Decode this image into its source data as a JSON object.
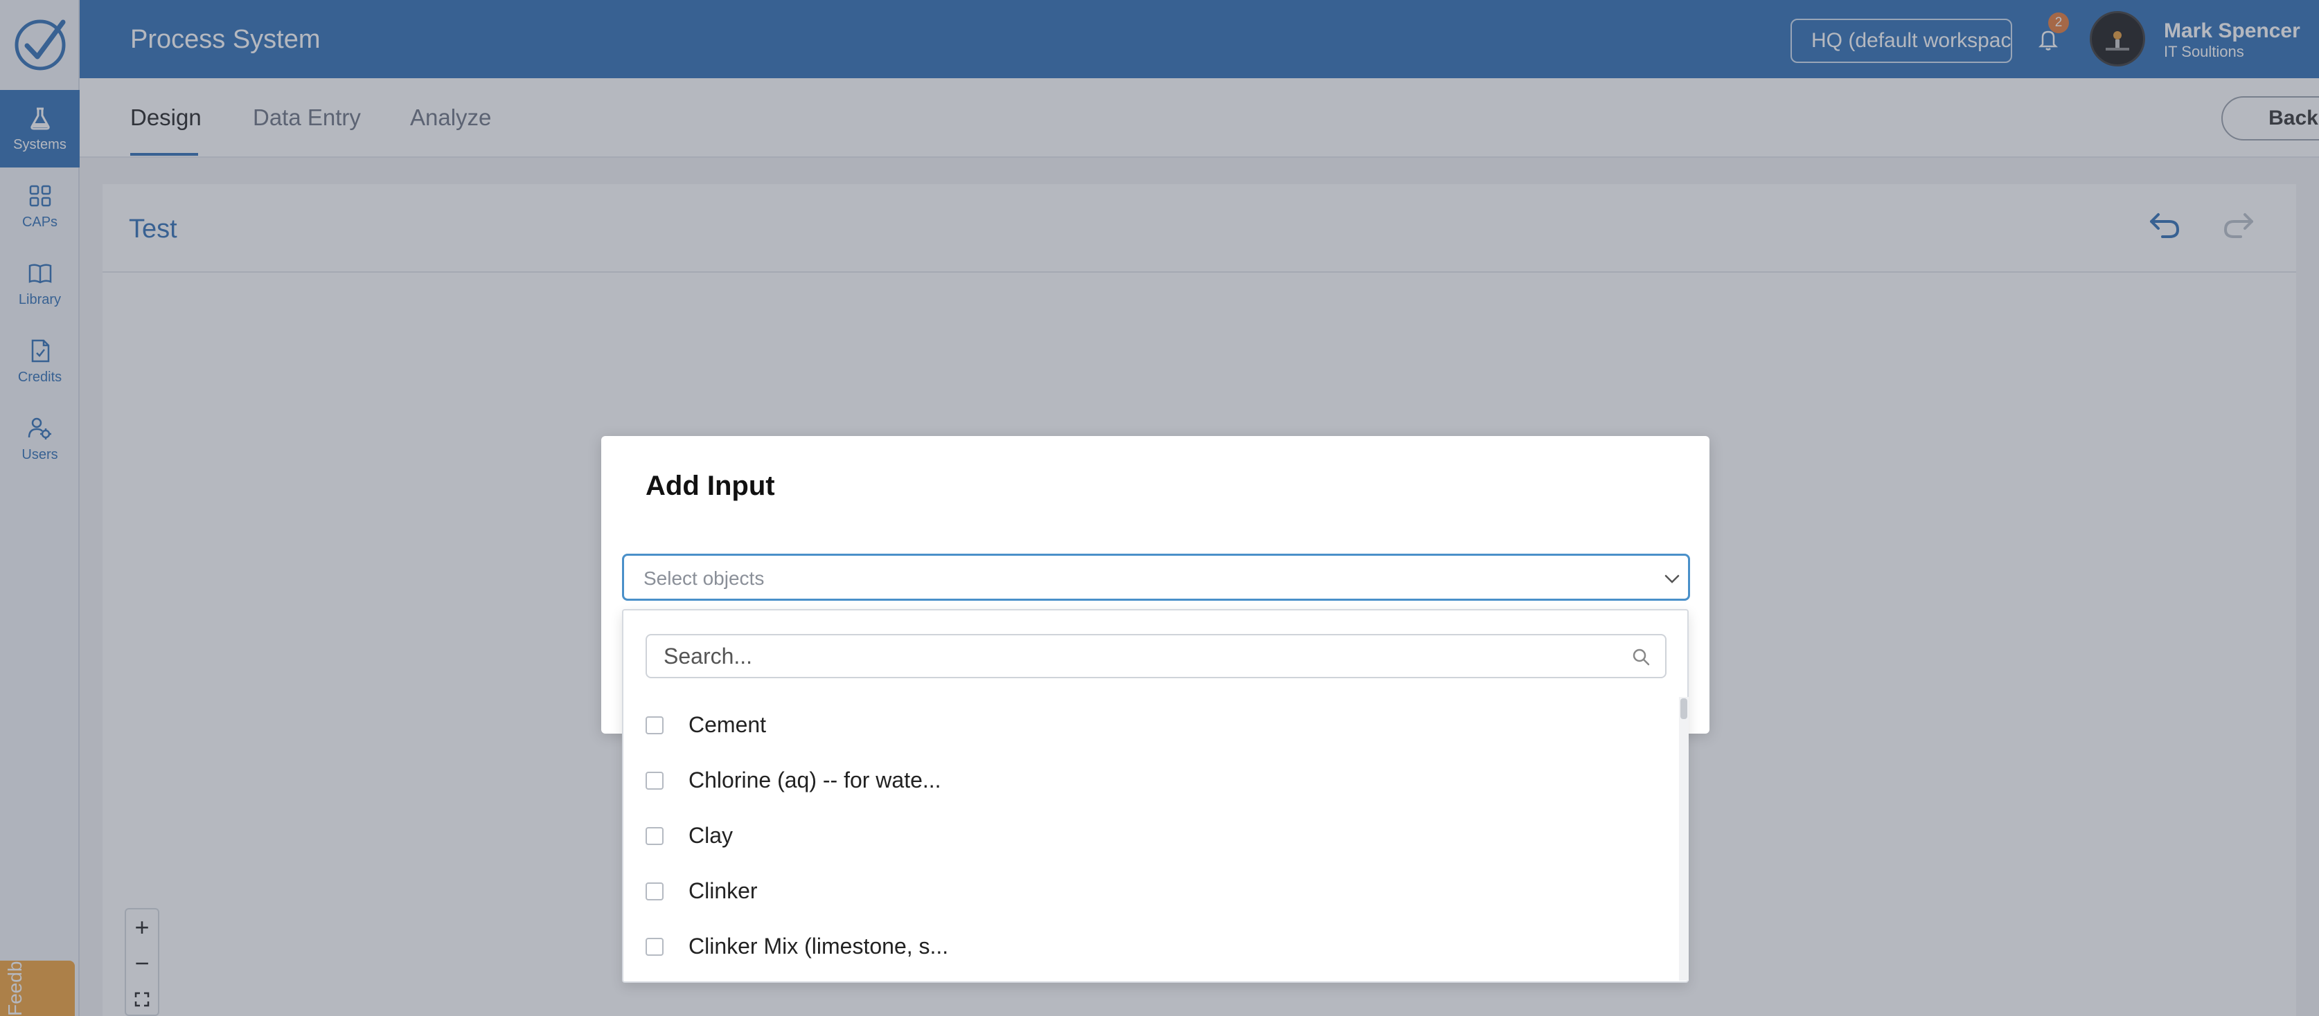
{
  "app": {
    "title": "Process System"
  },
  "header": {
    "workspace": "HQ (default workspace)",
    "notifications_count": "2",
    "user_name": "Mark Spencer",
    "user_org": "IT Soultions"
  },
  "sidebar": {
    "items": [
      {
        "label": "Systems",
        "icon": "flask-icon",
        "active": true
      },
      {
        "label": "CAPs",
        "icon": "grid-icon",
        "active": false
      },
      {
        "label": "Library",
        "icon": "book-icon",
        "active": false
      },
      {
        "label": "Credits",
        "icon": "document-check-icon",
        "active": false
      },
      {
        "label": "Users",
        "icon": "users-gear-icon",
        "active": false
      }
    ],
    "feedback_label": "Feedback"
  },
  "tabs": [
    {
      "label": "Design",
      "active": true
    },
    {
      "label": "Data Entry",
      "active": false
    },
    {
      "label": "Analyze",
      "active": false
    }
  ],
  "toolbar": {
    "back_label": "Back"
  },
  "canvas": {
    "title": "Test"
  },
  "zoom": {
    "in": "+",
    "out": "−"
  },
  "modal": {
    "title": "Add Input",
    "select_placeholder": "Select objects",
    "search_placeholder": "Search...",
    "options": [
      "Cement",
      "Chlorine (aq) -- for wate...",
      "Clay",
      "Clinker",
      "Clinker Mix (limestone, s..."
    ]
  },
  "colors": {
    "primary": "#2f6fb5",
    "badge": "#e57a38",
    "feedback": "#f0a23b"
  }
}
